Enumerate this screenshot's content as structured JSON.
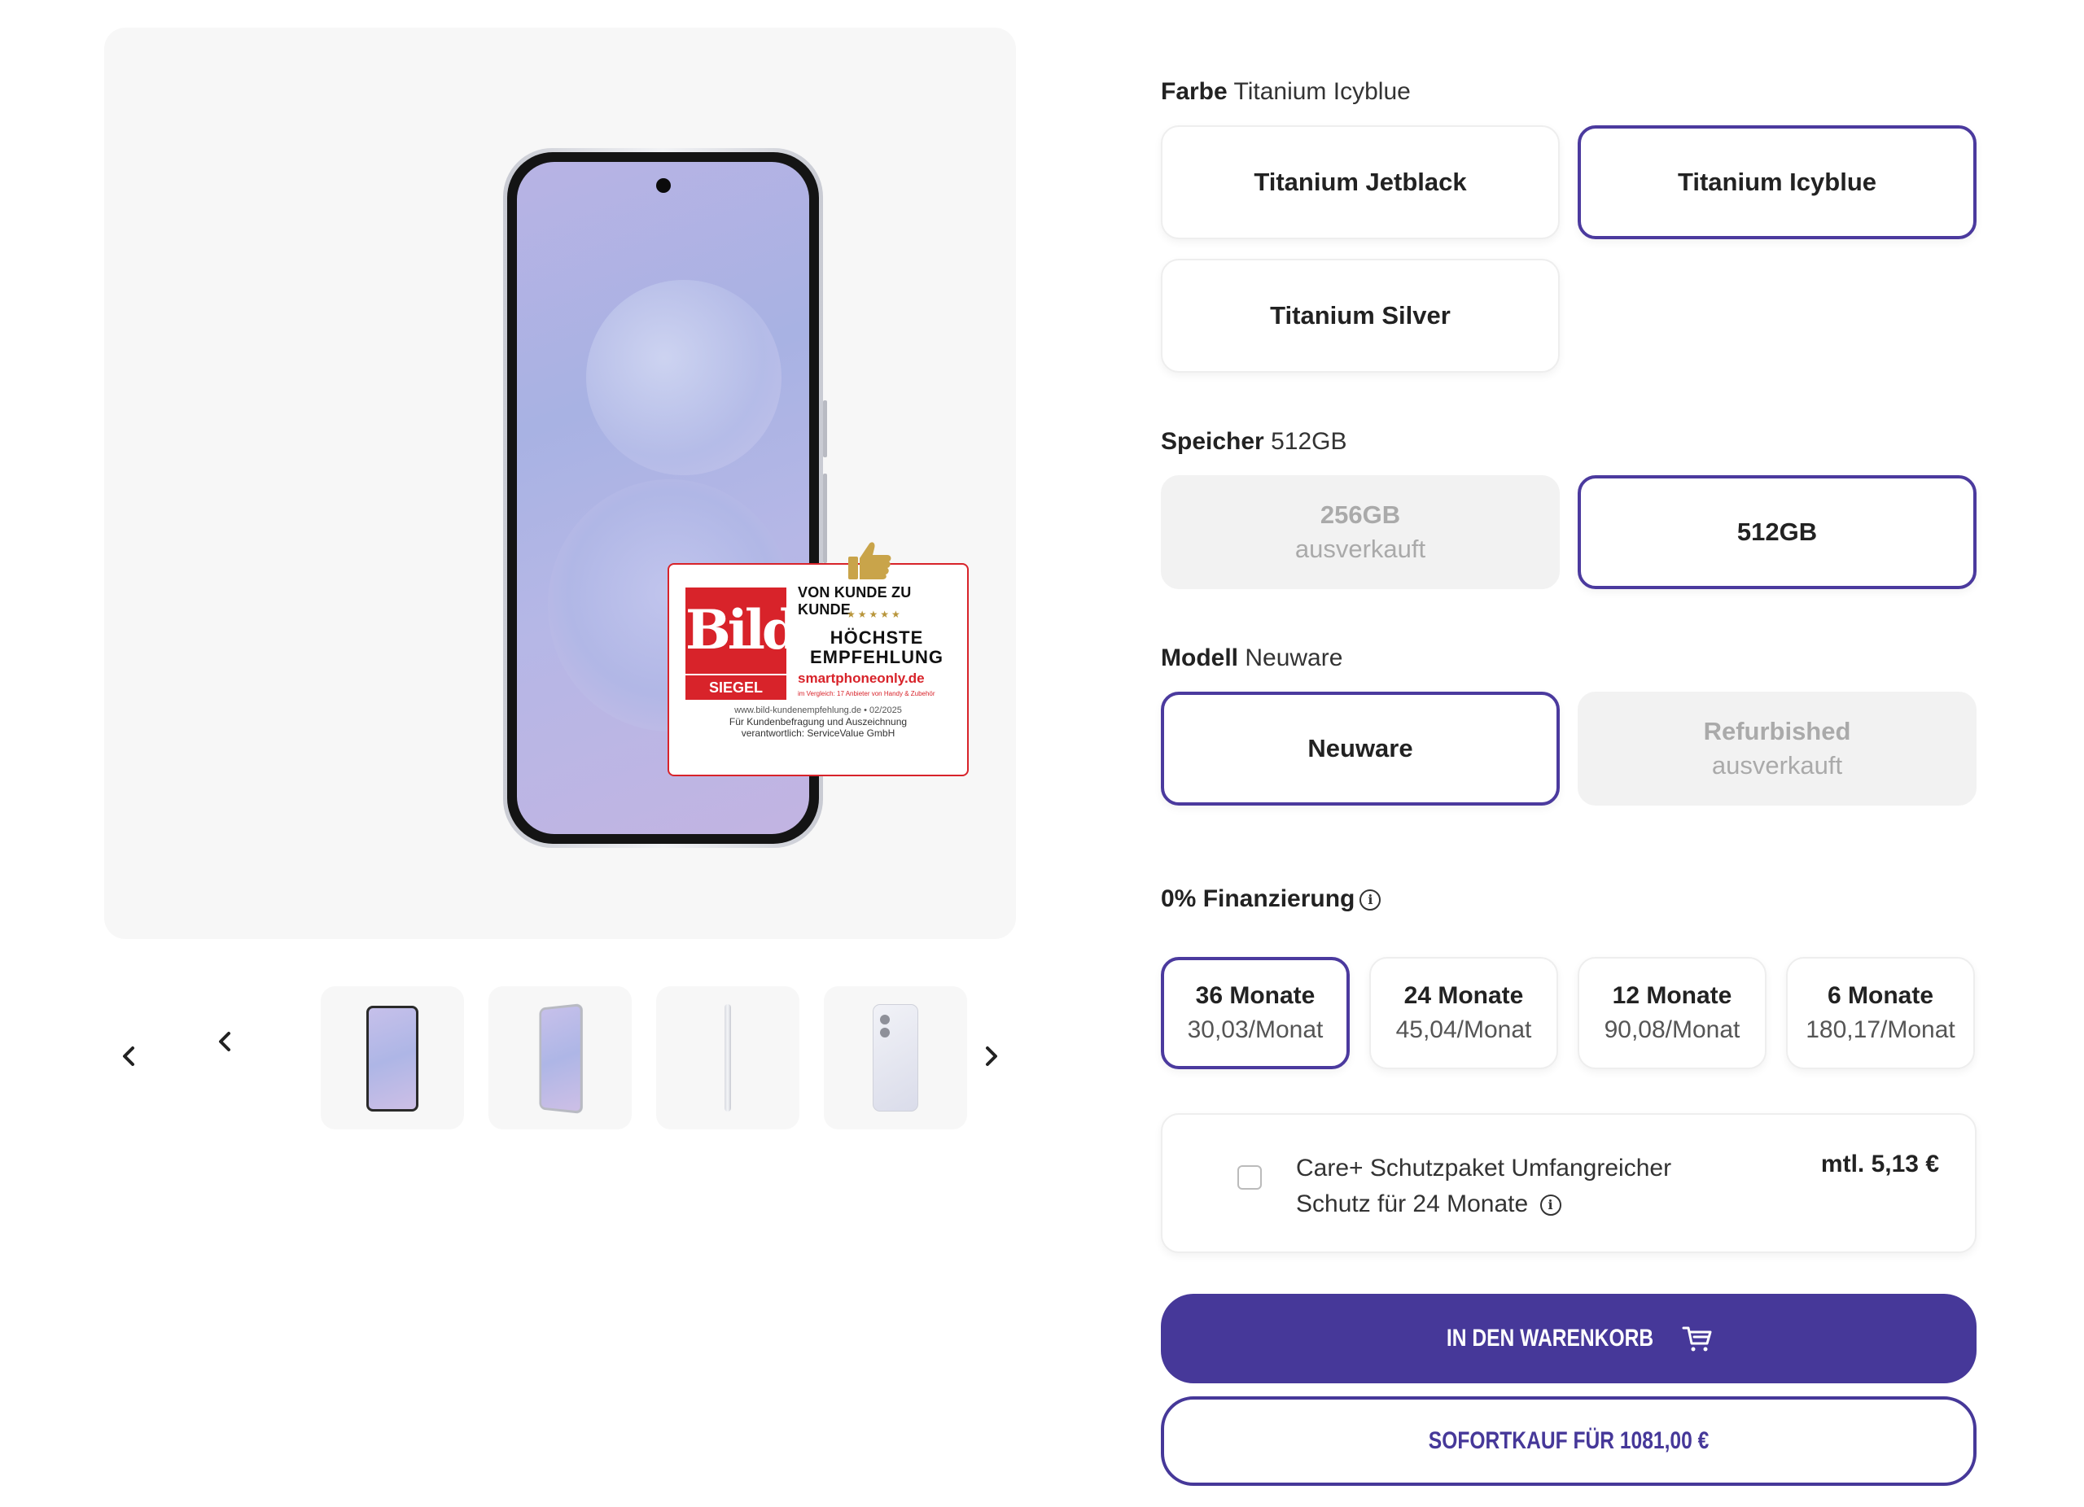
{
  "colors": {
    "accent": "#463899",
    "selected_border": "#4b3a9e",
    "disabled_bg": "#f2f2f2",
    "badge_red": "#d8232a"
  },
  "gallery": {
    "badge": {
      "logo_word": "Bild",
      "logo_sub": "SIEGEL",
      "headline": "VON KUNDE ZU KUNDE",
      "stars": "★★★★★",
      "award": "HÖCHSTE EMPFEHLUNG",
      "site": "smartphoneonly.de",
      "compare_note": "im Vergleich: 17 Anbieter von Handy & Zubehör",
      "footer_url": "www.bild-kundenempfehlung.de • 02/2025",
      "footer_line2": "Für Kundenbefragung und Auszeichnung",
      "footer_line3": "verantwortlich: ServiceValue GmbH"
    },
    "thumbnails": [
      "front",
      "front-angled",
      "side",
      "back"
    ],
    "icons": {
      "prev_outer": "chevron-left-icon",
      "prev_inner": "chevron-left-icon",
      "next": "chevron-right-icon"
    }
  },
  "color_option": {
    "label": "Farbe",
    "value": "Titanium Icyblue",
    "options": [
      {
        "name": "Titanium Jetblack",
        "selected": false
      },
      {
        "name": "Titanium Icyblue",
        "selected": true
      },
      {
        "name": "Titanium Silver",
        "selected": false
      }
    ]
  },
  "storage_option": {
    "label": "Speicher",
    "value": "512GB",
    "options": [
      {
        "name": "256GB",
        "sub": "ausverkauft",
        "selected": false,
        "disabled": true
      },
      {
        "name": "512GB",
        "selected": true,
        "disabled": false
      }
    ]
  },
  "model_option": {
    "label": "Modell",
    "value": "Neuware",
    "options": [
      {
        "name": "Neuware",
        "selected": true,
        "disabled": false
      },
      {
        "name": "Refurbished",
        "sub": "ausverkauft",
        "selected": false,
        "disabled": true
      }
    ]
  },
  "financing": {
    "label": "0% Finanzierung",
    "info_icon": "info-icon",
    "terms": [
      {
        "months": "36 Monate",
        "rate": "30,03/Monat",
        "selected": true
      },
      {
        "months": "24 Monate",
        "rate": "45,04/Monat",
        "selected": false
      },
      {
        "months": "12 Monate",
        "rate": "90,08/Monat",
        "selected": false
      },
      {
        "months": "6 Monate",
        "rate": "180,17/Monat",
        "selected": false
      }
    ]
  },
  "care_plus": {
    "checked": false,
    "text": "Care+ Schutzpaket Umfangreicher Schutz für 24 Monate",
    "price": "mtl. 5,13 €"
  },
  "actions": {
    "add_to_cart": "IN DEN WARENKORB",
    "cart_icon": "shopping-cart-icon",
    "buy_now": "SOFORTKAUF FÜR 1081,00 €"
  }
}
